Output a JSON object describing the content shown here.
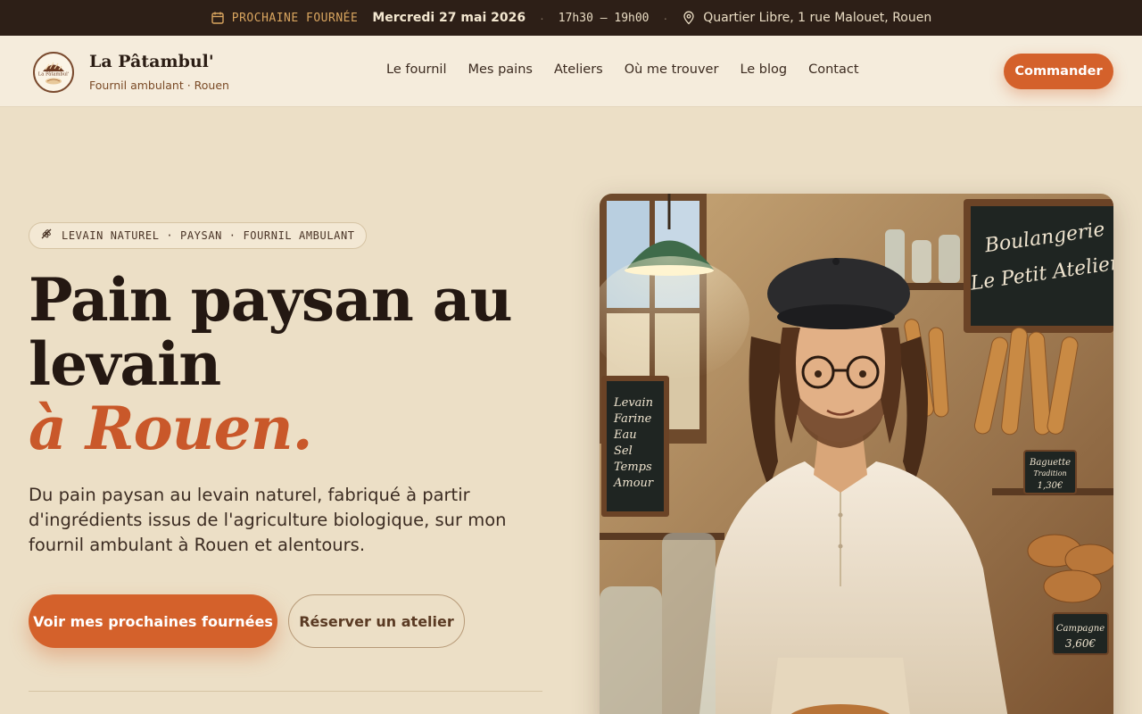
{
  "topbar": {
    "label": "PROCHAINE FOURNÉE",
    "date": "Mercredi 27 mai 2026",
    "separator": "·",
    "hours": "17h30 – 19h00",
    "address": "Quartier Libre, 1 rue Malouet, Rouen",
    "icons": {
      "calendar": "calendar-icon",
      "location": "map-pin-icon"
    },
    "colors": {
      "background": "#2d1f17",
      "label": "#d9a55f"
    }
  },
  "header": {
    "brand_name": "La Pâtambul'",
    "brand_sub": "Fournil ambulant · Rouen",
    "logo_text": "La Pâtambul'",
    "nav": [
      "Le fournil",
      "Mes pains",
      "Ateliers",
      "Où me trouver",
      "Le blog",
      "Contact"
    ],
    "cta": "Commander"
  },
  "hero": {
    "tag": "LEVAIN NATUREL · PAYSAN · FOURNIL AMBULANT",
    "title_line1": "Pain paysan au",
    "title_line2": "levain",
    "title_accent": "à Rouen.",
    "lead": "Du pain paysan au levain naturel, fabriqué à partir d'ingrédients issus de l'agriculture biologique, sur mon fournil ambulant à Rouen et alentours.",
    "primary_button": "Voir mes prochaines fournées",
    "secondary_button": "Réserver un atelier"
  },
  "illustration": {
    "sign_line1": "Boulangerie",
    "sign_line2": "Le Petit Atelier",
    "board_items": [
      "Levain",
      "Farine",
      "Eau",
      "Sel",
      "Temps",
      "Amour"
    ],
    "price_tag1_name": "Baguette",
    "price_tag1_sub": "Tradition",
    "price_tag1_price": "1,30€",
    "price_tag2_name": "Campagne",
    "price_tag2_price": "3,60€"
  },
  "colors": {
    "accent": "#d4612b",
    "background": "#ecdfc6",
    "header_bg": "#f5ecdc",
    "text": "#241812"
  }
}
